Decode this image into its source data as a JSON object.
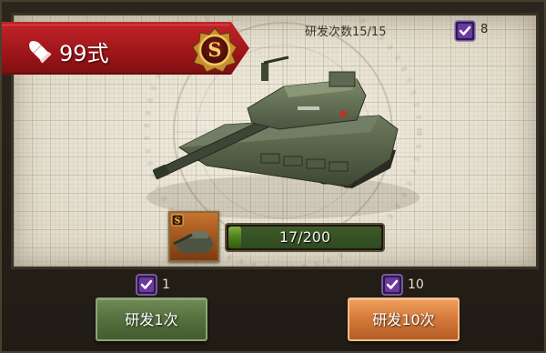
{
  "tank": {
    "name": "99式",
    "rank": "S"
  },
  "research": {
    "count_label": "研发次数15/15",
    "ticket_total": "8"
  },
  "progress": {
    "text": "17/200",
    "current": 17,
    "max": 200
  },
  "options": [
    {
      "cost": "1",
      "label": "研发1次"
    },
    {
      "cost": "10",
      "label": "研发10次"
    }
  ],
  "icons": {
    "name": "bullet-icon",
    "rank": "s-rank-badge-icon",
    "ticket": "research-ticket-icon",
    "tank": "tank-image"
  },
  "colors": {
    "banner": "#b01e22",
    "badge": "#d9a441",
    "ticket": "#6b3a9e",
    "progress_fill": "#6aa230",
    "btn_single": "#5c7745",
    "btn_ten": "#dc8442"
  }
}
